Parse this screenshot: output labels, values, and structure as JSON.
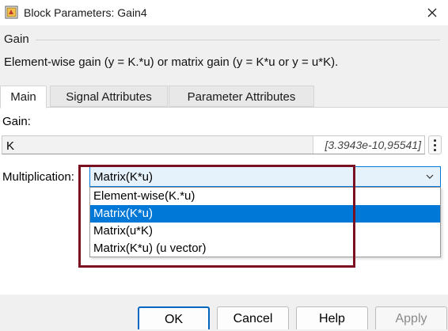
{
  "window": {
    "title": "Block Parameters: Gain4",
    "icons": {
      "app": "simulink-block-icon",
      "close": "close-icon"
    }
  },
  "group": {
    "title": "Gain",
    "description": "Element-wise gain (y = K.*u) or matrix gain (y = K*u or y = u*K)."
  },
  "tabs": [
    {
      "label": "Main",
      "active": true
    },
    {
      "label": "Signal Attributes",
      "active": false
    },
    {
      "label": "Parameter Attributes",
      "active": false
    }
  ],
  "gain": {
    "label": "Gain:",
    "value": "K",
    "range": "[3.3943e-10,95541]"
  },
  "multiplication": {
    "label": "Multiplication:",
    "selected": "Matrix(K*u)",
    "options": [
      {
        "label": "Element-wise(K.*u)",
        "selected": false
      },
      {
        "label": "Matrix(K*u)",
        "selected": true
      },
      {
        "label": "Matrix(u*K)",
        "selected": false
      },
      {
        "label": "Matrix(K*u) (u vector)",
        "selected": false
      }
    ]
  },
  "buttons": {
    "ok": "OK",
    "cancel": "Cancel",
    "help": "Help",
    "apply": "Apply"
  },
  "colors": {
    "accent": "#0078d7",
    "highlight_box": "#7b1020",
    "select_bg": "#e5f1fb"
  }
}
